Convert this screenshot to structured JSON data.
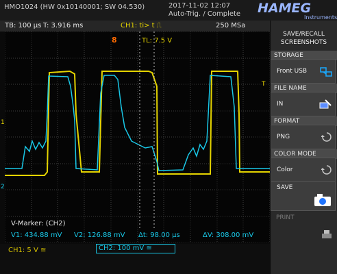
{
  "header": {
    "model": "HMO1024 (HW 0x10140001; SW 04.530)",
    "date": "2017-11-02 12:07",
    "trigger_status": "Auto-Trig. / Complete",
    "logo_text": "HAMEG",
    "logo_sub": "Instruments"
  },
  "infobar": {
    "timebase": "TB: 100 µs",
    "time_offset": "T: 3.916 ms",
    "trigger": "CH1: ti> t ⎍",
    "sample_rate": "250 MSa"
  },
  "trigger_markers": {
    "position": "8",
    "level_label": "TL: 7.5 V",
    "level_arrow": "T"
  },
  "markers": {
    "title": "V-Marker: (CH2)",
    "v1": "V1: 434.88 mV",
    "v2": "V2: 126.88 mV",
    "dt": "Δt: 98.00 µs",
    "dv": "ΔV: 308.00 mV"
  },
  "channels": {
    "ch1_label": "1",
    "ch2_label": "2",
    "ch1_scale": "CH1: 5 V ≅",
    "ch2_scale": "CH2: 100 mV ≅",
    "ch1_color": "#e5d400",
    "ch2_color": "#19c7e6"
  },
  "sidebar": {
    "title_line1": "SAVE/RECALL",
    "title_line2": "SCREENSHOTS",
    "storage_label": "STORAGE",
    "storage_value": "Front USB",
    "filename_label": "FILE NAME",
    "filename_value": "IN",
    "format_label": "FORMAT",
    "format_value": "PNG",
    "colormode_label": "COLOR MODE",
    "colormode_value": "Color",
    "save_label": "SAVE",
    "print_label": "PRINT"
  }
}
